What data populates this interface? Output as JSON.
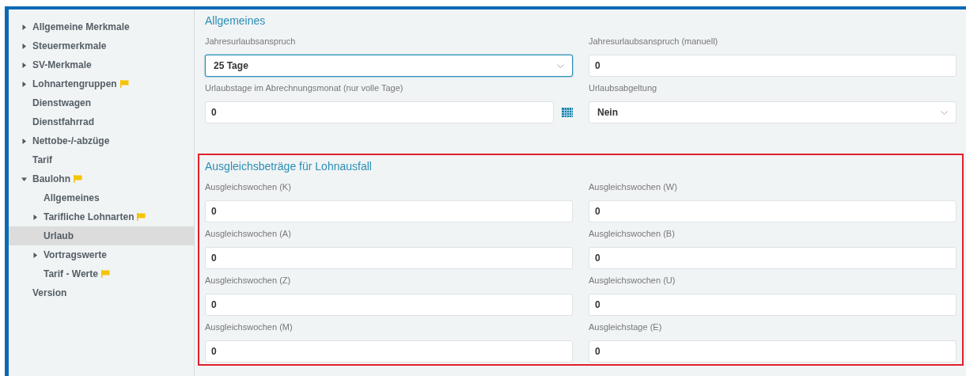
{
  "sidebar": {
    "items": [
      {
        "label": "Allgemeine Merkmale",
        "kind": "group",
        "expanded": false,
        "flagged": false,
        "selected": false
      },
      {
        "label": "Steuermerkmale",
        "kind": "group",
        "expanded": false,
        "flagged": false,
        "selected": false
      },
      {
        "label": "SV-Merkmale",
        "kind": "group",
        "expanded": false,
        "flagged": false,
        "selected": false
      },
      {
        "label": "Lohnartengruppen",
        "kind": "group",
        "expanded": false,
        "flagged": true,
        "selected": false
      },
      {
        "label": "Dienstwagen",
        "kind": "leaf",
        "flagged": false,
        "selected": false
      },
      {
        "label": "Dienstfahrrad",
        "kind": "leaf",
        "flagged": false,
        "selected": false
      },
      {
        "label": "Nettobe-/-abzüge",
        "kind": "group",
        "expanded": false,
        "flagged": false,
        "selected": false
      },
      {
        "label": "Tarif",
        "kind": "leaf",
        "flagged": false,
        "selected": false
      },
      {
        "label": "Baulohn",
        "kind": "group",
        "expanded": true,
        "flagged": true,
        "selected": false,
        "children": [
          {
            "label": "Allgemeines",
            "kind": "leaf",
            "flagged": false,
            "selected": false
          },
          {
            "label": "Tarifliche Lohnarten",
            "kind": "group",
            "expanded": false,
            "flagged": true,
            "selected": false
          },
          {
            "label": "Urlaub",
            "kind": "leaf",
            "flagged": false,
            "selected": true
          },
          {
            "label": "Vortragswerte",
            "kind": "group",
            "expanded": false,
            "flagged": false,
            "selected": false
          },
          {
            "label": "Tarif - Werte",
            "kind": "leaf",
            "flagged": true,
            "selected": false
          }
        ]
      },
      {
        "label": "Version",
        "kind": "leaf",
        "flagged": false,
        "selected": false
      }
    ]
  },
  "sections": [
    {
      "title": "Allgemeines",
      "highlighted": false,
      "fields": [
        {
          "label": "Jahresurlaubsanspruch",
          "kind": "select",
          "value": "25 Tage",
          "focused": true
        },
        {
          "label": "Jahresurlaubsanspruch (manuell)",
          "kind": "input",
          "value": "0",
          "focused": false
        },
        {
          "label": "Urlaubstage im Abrechnungsmonat (nur volle Tage)",
          "kind": "calendar",
          "value": "0",
          "focused": false
        },
        {
          "label": "Urlaubsabgeltung",
          "kind": "select",
          "value": "Nein",
          "focused": false
        }
      ]
    },
    {
      "title": "Ausgleichsbeträge für Lohnausfall",
      "highlighted": true,
      "fields": [
        {
          "label": "Ausgleichswochen (K)",
          "kind": "input",
          "value": "0",
          "focused": false
        },
        {
          "label": "Ausgleichswochen (W)",
          "kind": "input",
          "value": "0",
          "focused": false
        },
        {
          "label": "Ausgleichswochen (A)",
          "kind": "input",
          "value": "0",
          "focused": false
        },
        {
          "label": "Ausgleichswochen (B)",
          "kind": "input",
          "value": "0",
          "focused": false
        },
        {
          "label": "Ausgleichswochen (Z)",
          "kind": "input",
          "value": "0",
          "focused": false
        },
        {
          "label": "Ausgleichswochen (U)",
          "kind": "input",
          "value": "0",
          "focused": false
        },
        {
          "label": "Ausgleichswochen (M)",
          "kind": "input",
          "value": "0",
          "focused": false
        },
        {
          "label": "Ausgleichstage (E)",
          "kind": "input",
          "value": "0",
          "focused": false
        }
      ]
    }
  ]
}
